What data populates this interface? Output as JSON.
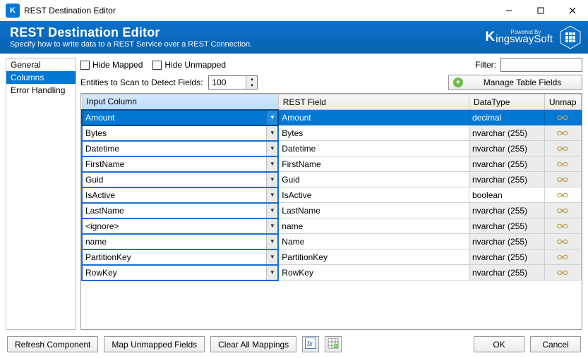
{
  "window": {
    "title": "REST Destination Editor"
  },
  "banner": {
    "title": "REST Destination Editor",
    "subtitle": "Specify how to write data to a REST Service over a REST Connection.",
    "brand_powered": "Powered By",
    "brand_name_k": "K",
    "brand_name_rest": "ingswaySoft"
  },
  "sidebar": {
    "items": [
      "General",
      "Columns",
      "Error Handling"
    ],
    "selected_index": 1
  },
  "toolbar": {
    "hide_mapped": "Hide Mapped",
    "hide_unmapped": "Hide Unmapped",
    "filter_label": "Filter:",
    "filter_value": ""
  },
  "row2": {
    "label": "Entities to Scan to Detect Fields:",
    "value": "100",
    "manage_label": "Manage Table Fields"
  },
  "table": {
    "headers": {
      "input": "Input Column",
      "field": "REST Field",
      "datatype": "DataType",
      "unmap": "Unmap"
    },
    "rows": [
      {
        "input": "Amount",
        "field": "Amount",
        "datatype": "decimal",
        "dt_grey": false,
        "selected": true
      },
      {
        "input": "Bytes",
        "field": "Bytes",
        "datatype": "nvarchar (255)",
        "dt_grey": true,
        "selected": false
      },
      {
        "input": "Datetime",
        "field": "Datetime",
        "datatype": "nvarchar (255)",
        "dt_grey": true,
        "selected": false
      },
      {
        "input": "FirstName",
        "field": "FirstName",
        "datatype": "nvarchar (255)",
        "dt_grey": true,
        "selected": false
      },
      {
        "input": "Guid",
        "field": "Guid",
        "datatype": "nvarchar (255)",
        "dt_grey": true,
        "selected": false
      },
      {
        "input": "IsActive",
        "field": "IsActive",
        "datatype": "boolean",
        "dt_grey": false,
        "selected": false
      },
      {
        "input": "LastName",
        "field": "LastName",
        "datatype": "nvarchar (255)",
        "dt_grey": true,
        "selected": false
      },
      {
        "input": "<ignore>",
        "field": "name",
        "datatype": "nvarchar (255)",
        "dt_grey": true,
        "selected": false
      },
      {
        "input": "name",
        "field": "Name",
        "datatype": "nvarchar (255)",
        "dt_grey": true,
        "selected": false
      },
      {
        "input": "PartitionKey",
        "field": "PartitionKey",
        "datatype": "nvarchar (255)",
        "dt_grey": true,
        "selected": false
      },
      {
        "input": "RowKey",
        "field": "RowKey",
        "datatype": "nvarchar (255)",
        "dt_grey": true,
        "selected": false
      }
    ]
  },
  "footer": {
    "refresh": "Refresh Component",
    "mapunmapped": "Map Unmapped Fields",
    "clearall": "Clear All Mappings",
    "ok": "OK",
    "cancel": "Cancel"
  }
}
